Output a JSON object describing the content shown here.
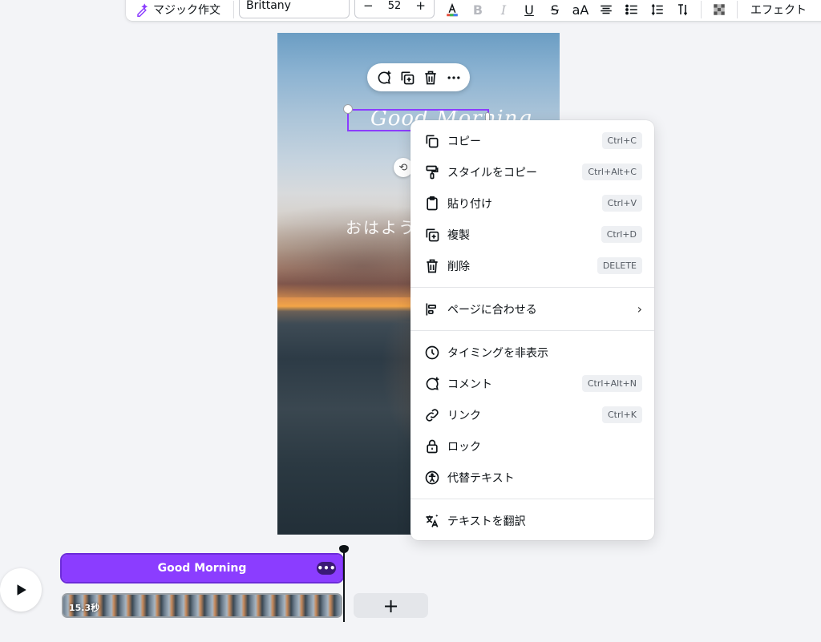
{
  "toolbar": {
    "magic_write": "マジック作文",
    "font_name": "Brittany",
    "size_minus": "−",
    "font_size": "52",
    "size_plus": "+",
    "case_label": "aA",
    "effects": "エフェクト"
  },
  "canvas": {
    "script_text": "Good Morning",
    "jp_text": "おはよう"
  },
  "menu": {
    "items": [
      {
        "label": "コピー",
        "shortcut": "Ctrl+C",
        "icon": "copy-icon"
      },
      {
        "label": "スタイルをコピー",
        "shortcut": "Ctrl+Alt+C",
        "icon": "paint-roller-icon"
      },
      {
        "label": "貼り付け",
        "shortcut": "Ctrl+V",
        "icon": "clipboard-icon"
      },
      {
        "label": "複製",
        "shortcut": "Ctrl+D",
        "icon": "duplicate-icon"
      },
      {
        "label": "削除",
        "shortcut": "DELETE",
        "icon": "trash-icon"
      },
      {
        "label": "ページに合わせる",
        "icon": "align-left-icon"
      },
      {
        "label": "タイミングを非表示",
        "icon": "clock-icon"
      },
      {
        "label": "コメント",
        "shortcut": "Ctrl+Alt+N",
        "icon": "comment-icon"
      },
      {
        "label": "リンク",
        "shortcut": "Ctrl+K",
        "icon": "link-icon"
      },
      {
        "label": "ロック",
        "icon": "lock-icon"
      },
      {
        "label": "代替テキスト",
        "icon": "accessibility-icon"
      },
      {
        "label": "テキストを翻訳",
        "icon": "translate-icon"
      }
    ]
  },
  "timeline": {
    "text_track_label": "Good Morning",
    "video_duration": "15.3秒",
    "add_label": "+"
  },
  "colors": {
    "accent": "#8b3dff",
    "menu_bg": "#ffffff",
    "page_bg": "#f3f4f7"
  }
}
